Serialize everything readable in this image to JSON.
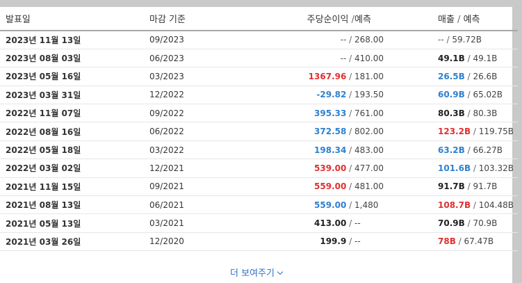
{
  "header": {
    "date": "발표일",
    "period": "마감 기준",
    "eps": "주당순이익",
    "sep": " / ",
    "forecast": "예측",
    "revenue": "매출"
  },
  "rows": [
    {
      "date": "2023년 11월 13일",
      "period": "09/2023",
      "eps_actual": "--",
      "eps_status": "dash",
      "eps_forecast": "268.00",
      "rev_actual": "--",
      "rev_status": "dash",
      "rev_forecast": "59.72B"
    },
    {
      "date": "2023년 08월 03일",
      "period": "06/2023",
      "eps_actual": "--",
      "eps_status": "dash",
      "eps_forecast": "410.00",
      "rev_actual": "49.1B",
      "rev_status": "neutral",
      "rev_forecast": "49.1B"
    },
    {
      "date": "2023년 05월 16일",
      "period": "03/2023",
      "eps_actual": "1367.96",
      "eps_status": "miss",
      "eps_forecast": "181.00",
      "rev_actual": "26.5B",
      "rev_status": "beat",
      "rev_forecast": "26.6B"
    },
    {
      "date": "2023년 03월 31일",
      "period": "12/2022",
      "eps_actual": "-29.82",
      "eps_status": "beat",
      "eps_forecast": "193.50",
      "rev_actual": "60.9B",
      "rev_status": "beat",
      "rev_forecast": "65.02B"
    },
    {
      "date": "2022년 11월 07일",
      "period": "09/2022",
      "eps_actual": "395.33",
      "eps_status": "beat",
      "eps_forecast": "761.00",
      "rev_actual": "80.3B",
      "rev_status": "neutral",
      "rev_forecast": "80.3B"
    },
    {
      "date": "2022년 08월 16일",
      "period": "06/2022",
      "eps_actual": "372.58",
      "eps_status": "beat",
      "eps_forecast": "802.00",
      "rev_actual": "123.2B",
      "rev_status": "miss",
      "rev_forecast": "119.75B"
    },
    {
      "date": "2022년 05월 18일",
      "period": "03/2022",
      "eps_actual": "198.34",
      "eps_status": "beat",
      "eps_forecast": "483.00",
      "rev_actual": "63.2B",
      "rev_status": "beat",
      "rev_forecast": "66.27B"
    },
    {
      "date": "2022년 03월 02일",
      "period": "12/2021",
      "eps_actual": "539.00",
      "eps_status": "miss",
      "eps_forecast": "477.00",
      "rev_actual": "101.6B",
      "rev_status": "beat",
      "rev_forecast": "103.32B"
    },
    {
      "date": "2021년 11월 15일",
      "period": "09/2021",
      "eps_actual": "559.00",
      "eps_status": "miss",
      "eps_forecast": "481.00",
      "rev_actual": "91.7B",
      "rev_status": "neutral",
      "rev_forecast": "91.7B"
    },
    {
      "date": "2021년 08월 13일",
      "period": "06/2021",
      "eps_actual": "559.00",
      "eps_status": "beat",
      "eps_forecast": "1,480",
      "rev_actual": "108.7B",
      "rev_status": "miss",
      "rev_forecast": "104.48B"
    },
    {
      "date": "2021년 05월 13일",
      "period": "03/2021",
      "eps_actual": "413.00",
      "eps_status": "neutral",
      "eps_forecast": "--",
      "rev_actual": "70.9B",
      "rev_status": "neutral",
      "rev_forecast": "70.9B"
    },
    {
      "date": "2021년 03월 26일",
      "period": "12/2020",
      "eps_actual": "199.9",
      "eps_status": "neutral",
      "eps_forecast": "--",
      "rev_actual": "78B",
      "rev_status": "miss",
      "rev_forecast": "67.47B"
    }
  ],
  "status_colors": {
    "beat": "#2f80d0",
    "miss": "#e03030",
    "neutral": "#222222"
  },
  "show_more": {
    "label": "더 보여주기",
    "icon": "chevron-down-icon"
  }
}
